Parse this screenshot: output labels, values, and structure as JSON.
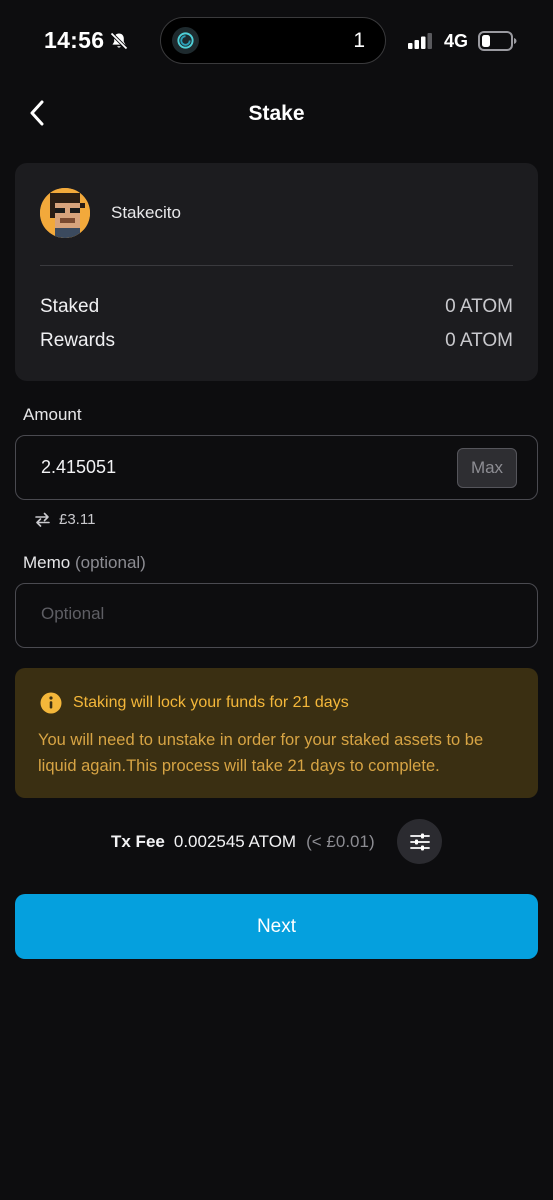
{
  "status_bar": {
    "time": "14:56",
    "island_count": "1",
    "network": "4G"
  },
  "header": {
    "title": "Stake"
  },
  "validator": {
    "name": "Stakecito",
    "staked_label": "Staked",
    "staked_value": "0 ATOM",
    "rewards_label": "Rewards",
    "rewards_value": "0 ATOM"
  },
  "amount": {
    "label": "Amount",
    "value": "2.415051",
    "max_label": "Max",
    "fiat": "£3.11"
  },
  "memo": {
    "label": "Memo",
    "label_hint": "(optional)",
    "placeholder": "Optional"
  },
  "warning": {
    "title": "Staking will lock your funds for 21 days",
    "body": "You will need to unstake in order for your staked assets to be liquid again.This process will take 21 days to complete."
  },
  "fee": {
    "label": "Tx Fee",
    "amount": "0.002545 ATOM",
    "fiat": "(< £0.01)"
  },
  "next_label": "Next",
  "colors": {
    "background": "#0d0d0f",
    "card": "#1c1c1f",
    "accent": "#05a0de",
    "warning_bg": "#3a2f12",
    "warning_text": "#f4b73a"
  },
  "icons": {
    "back": "chevron-left-icon",
    "bell": "bell-slash-icon",
    "swap": "swap-arrows-icon",
    "info": "info-circle-icon",
    "settings": "sliders-icon"
  }
}
